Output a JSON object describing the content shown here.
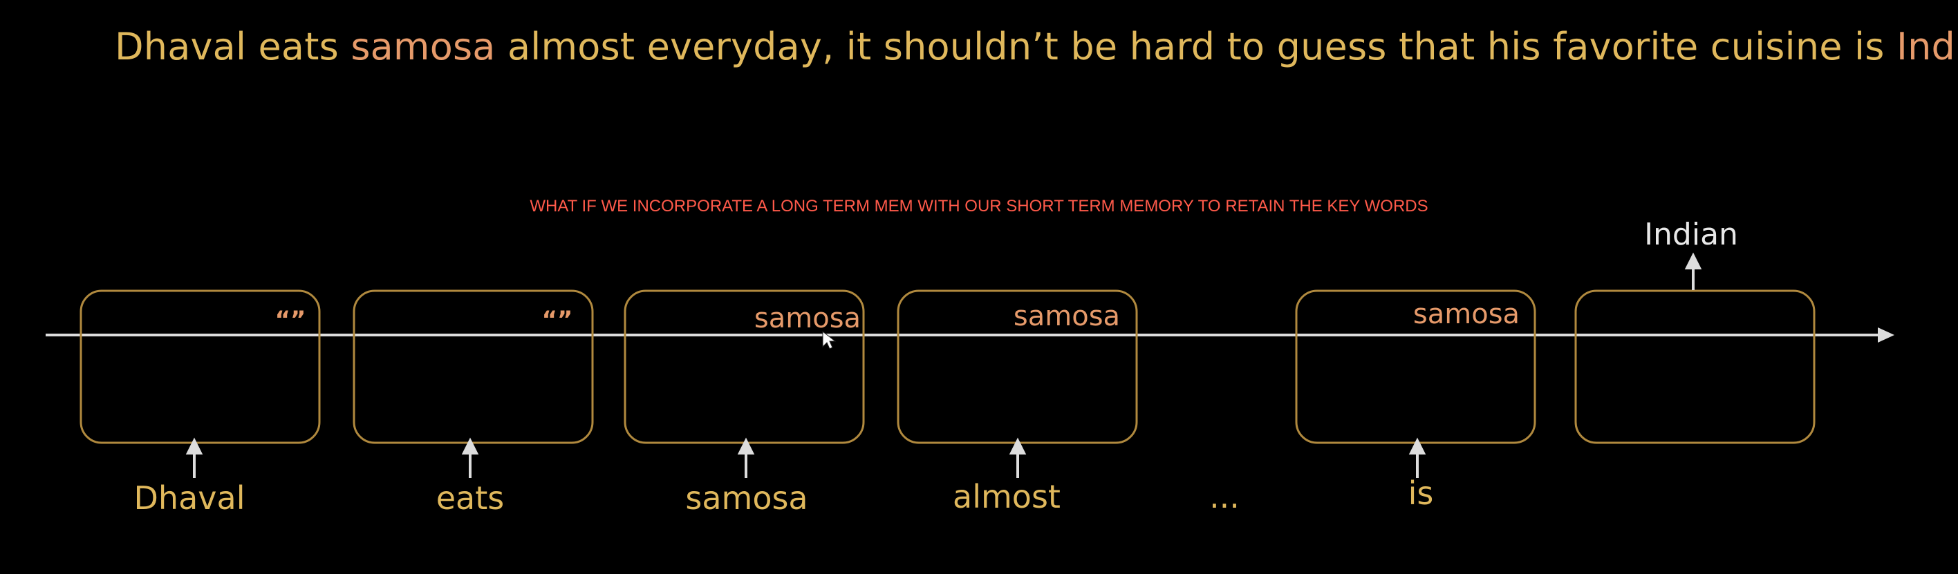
{
  "headline": {
    "part1": "Dhaval eats ",
    "highlight1": "samosa",
    "part2": " almost everyday, it shouldn’t be hard to guess that his favorite cuisine is ",
    "highlight2": "Indian"
  },
  "note": "WHAT IF WE INCORPORATE A LONG TERM MEM WITH OUR SHORT TERM MEMORY TO RETAIN THE KEY WORDS",
  "cells": [
    {
      "input": "Dhaval",
      "memory": "“”"
    },
    {
      "input": "eats",
      "memory": "“”"
    },
    {
      "input": "samosa",
      "memory": "samosa"
    },
    {
      "input": "almost",
      "memory": "samosa"
    },
    {
      "input": "is",
      "memory": "samosa"
    },
    {
      "input": "",
      "memory": ""
    }
  ],
  "ellipsis": "...",
  "output": "Indian",
  "colors": {
    "box_stroke": "#b0893e",
    "input_text": "#e0b85c",
    "memory_text": "#e69a6a",
    "line": "#dddddd",
    "note": "#ff5a4a"
  }
}
